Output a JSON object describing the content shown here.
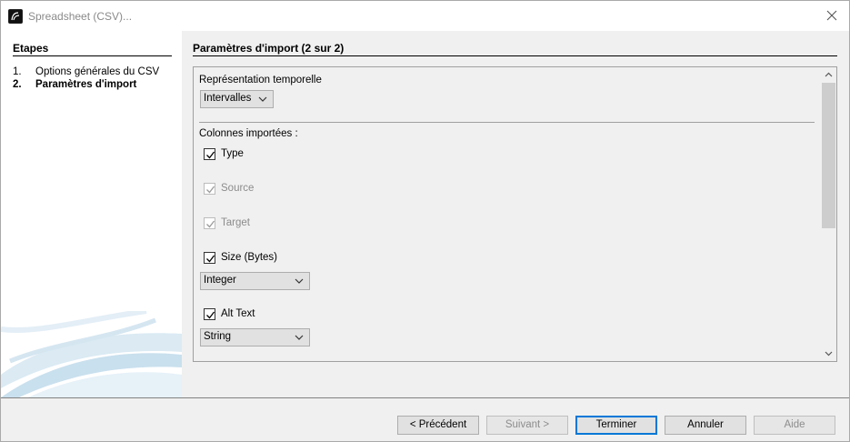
{
  "window": {
    "title": "Spreadsheet (CSV)..."
  },
  "sidebar": {
    "title": "Etapes",
    "steps": [
      {
        "num": "1.",
        "label": "Options générales du CSV",
        "active": false
      },
      {
        "num": "2.",
        "label": "Paramètres d'import",
        "active": true
      }
    ]
  },
  "main": {
    "title": "Paramètres d'import (2 sur 2)",
    "time_representation": {
      "label": "Représentation temporelle",
      "value": "Intervalles"
    },
    "columns_label": "Colonnes importées :",
    "columns": [
      {
        "label": "Type",
        "checked": true,
        "enabled": true
      },
      {
        "label": "Source",
        "checked": true,
        "enabled": false
      },
      {
        "label": "Target",
        "checked": true,
        "enabled": false
      },
      {
        "label": "Size (Bytes)",
        "checked": true,
        "enabled": true,
        "type": "Integer"
      },
      {
        "label": "Alt Text",
        "checked": true,
        "enabled": true,
        "type": "String"
      }
    ]
  },
  "buttons": {
    "previous": "< Précédent",
    "next": "Suivant >",
    "finish": "Terminer",
    "cancel": "Annuler",
    "help": "Aide"
  }
}
